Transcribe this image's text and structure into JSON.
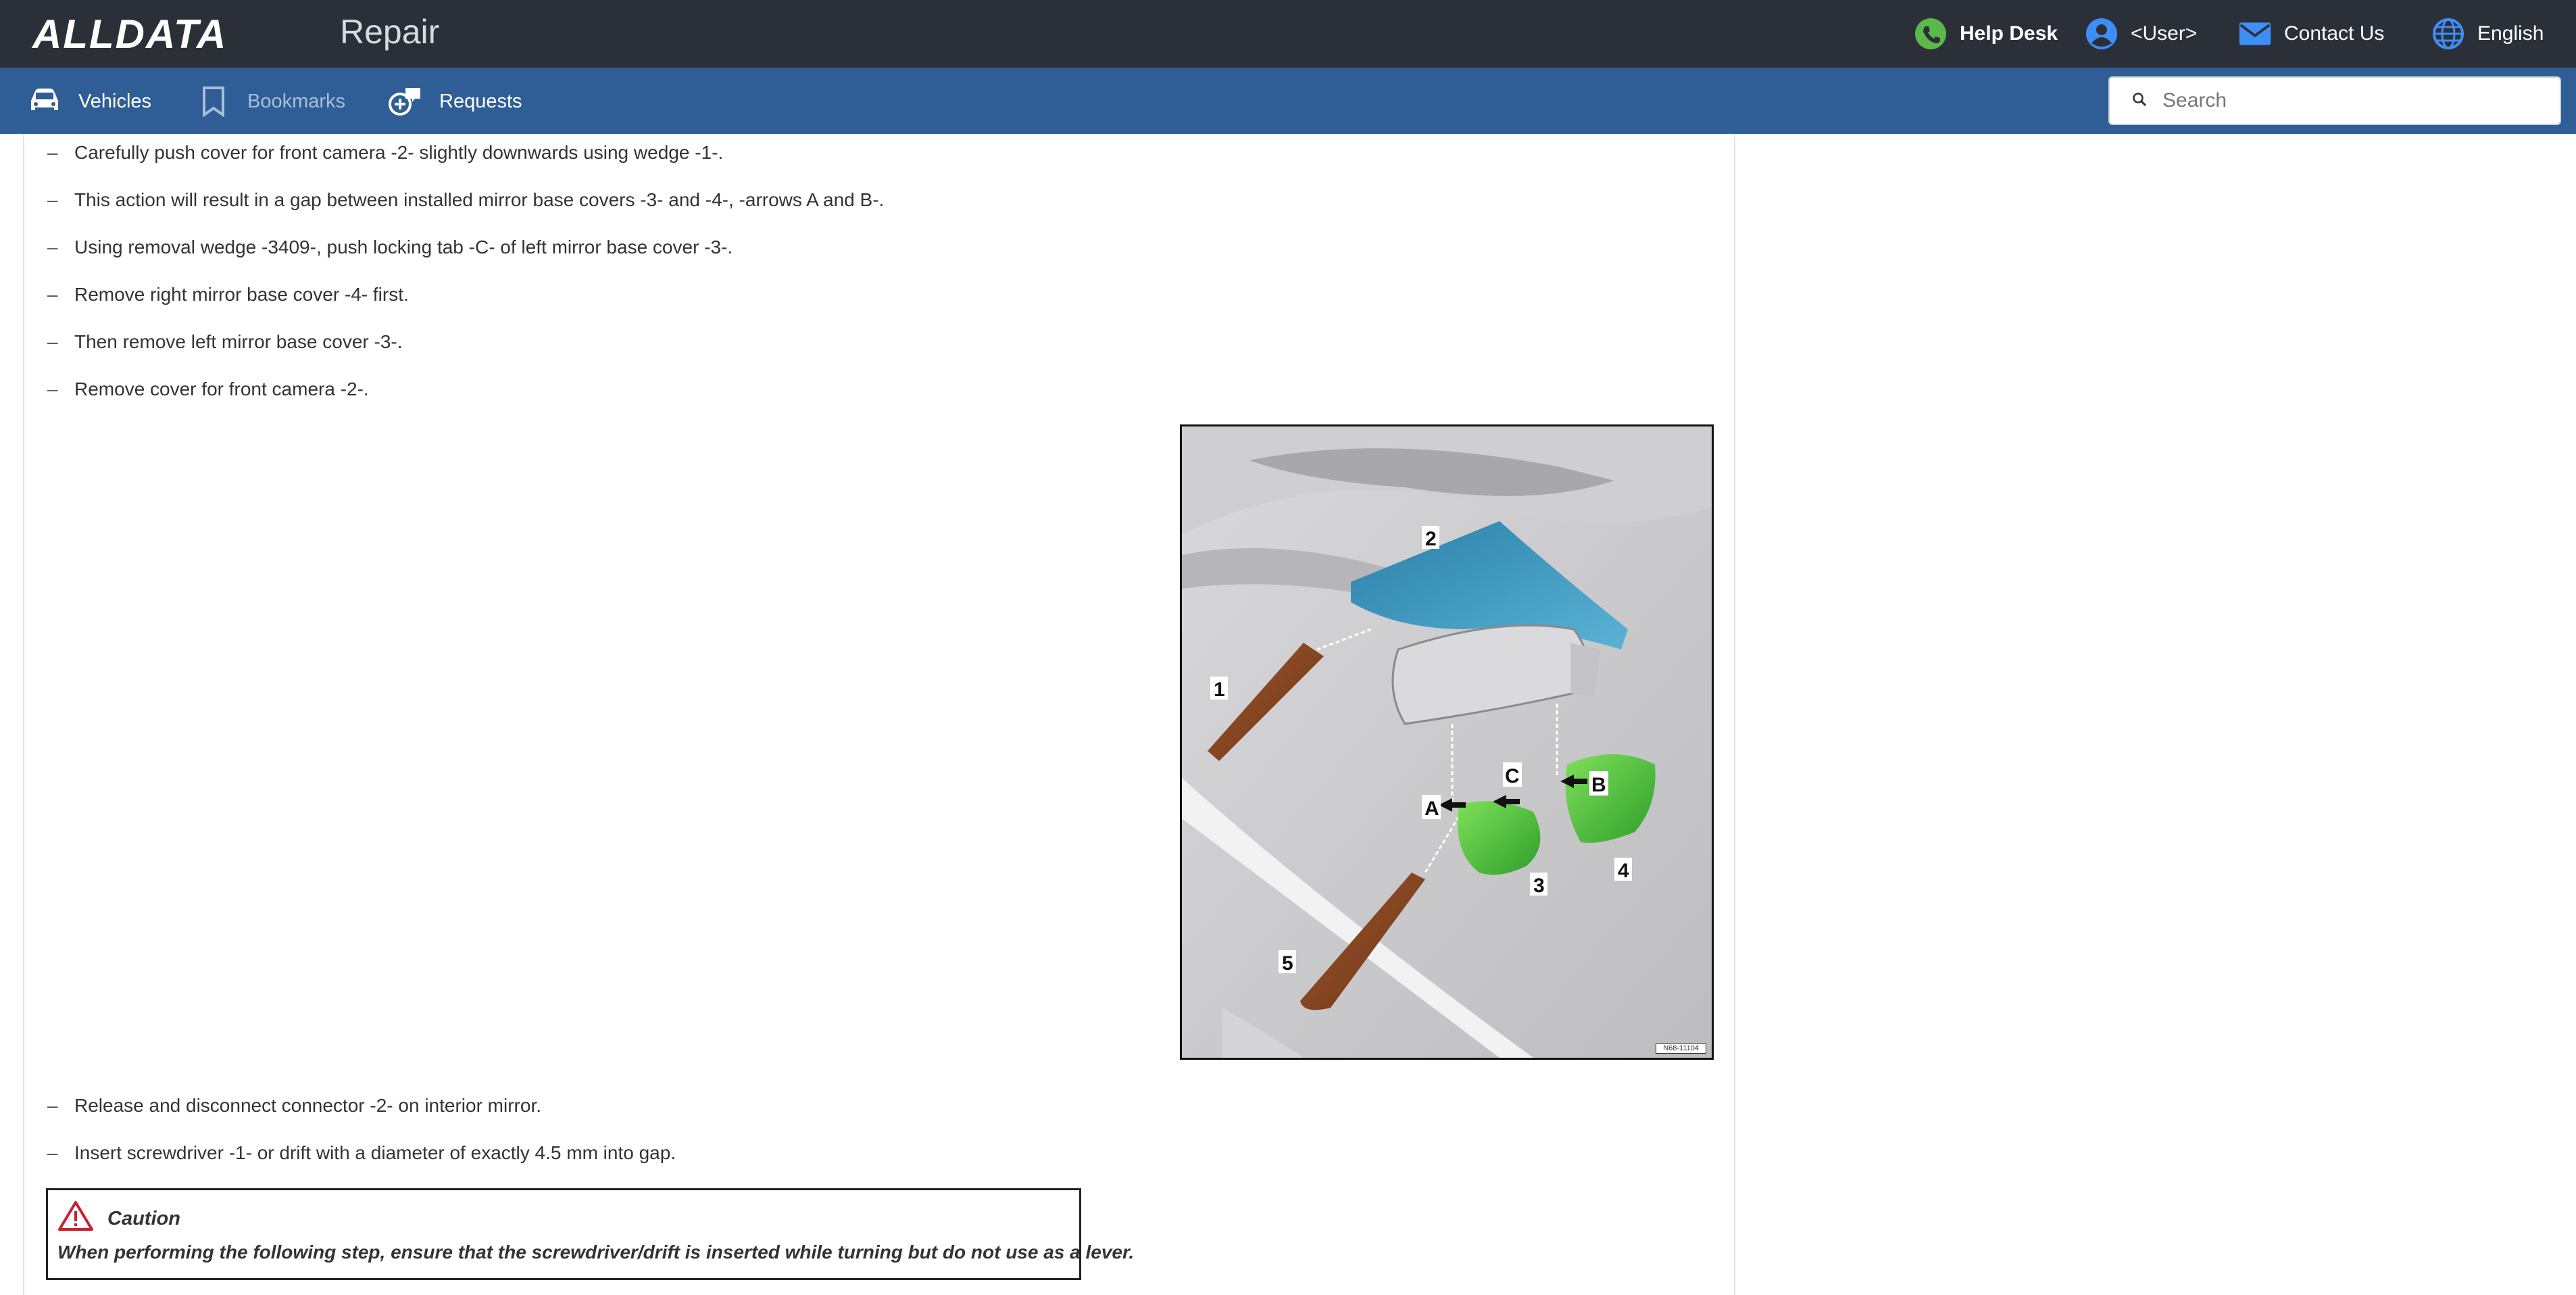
{
  "header": {
    "logo": "ALLDATA",
    "app_name": "Repair",
    "help_desk": "Help Desk",
    "user": "<User>",
    "contact_us": "Contact Us",
    "language": "English"
  },
  "nav": {
    "vehicles": "Vehicles",
    "bookmarks": "Bookmarks",
    "requests": "Requests",
    "search_placeholder": "Search"
  },
  "steps_top": [
    "Carefully push cover for front camera -2- slightly downwards using wedge -1-.",
    "This action will result in a gap between installed mirror base covers -3- and -4-, -arrows A and B-.",
    "Using removal wedge -3409-, push locking tab -C- of left mirror base cover -3-.",
    "Remove right mirror base cover -4- first.",
    "Then remove left mirror base cover -3-.",
    "Remove cover for front camera -2-."
  ],
  "figure": {
    "callouts": [
      "1",
      "2",
      "3",
      "4",
      "5",
      "A",
      "B",
      "C"
    ],
    "image_id": "N68-11104"
  },
  "steps_bottom": [
    "Release and disconnect connector -2- on interior mirror.",
    "Insert screwdriver -1- or drift with a diameter of exactly 4.5 mm into gap."
  ],
  "caution": {
    "title": "Caution",
    "text": "When performing the following step, ensure that the screwdriver/drift is inserted while turning but do not use as a lever."
  },
  "colors": {
    "header_bg": "#2b3038",
    "nav_bg": "#2f5d95",
    "help_icon": "#5bb84a",
    "user_icon": "#3e8ef7",
    "caution_icon": "#c8202f"
  },
  "icons": {
    "help": "phone-icon",
    "user": "user-circle-icon",
    "contact": "envelope-icon",
    "language": "globe-icon",
    "vehicles": "car-icon",
    "bookmarks": "bookmark-icon",
    "requests": "request-add-icon",
    "search": "search-icon",
    "caution": "warning-triangle-icon"
  }
}
